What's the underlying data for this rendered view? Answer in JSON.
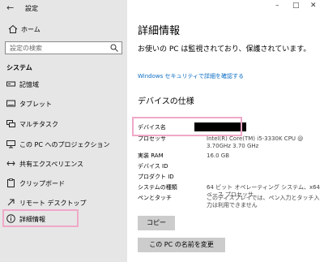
{
  "window": {
    "title": "設定",
    "back_icon": "back-arrow-icon"
  },
  "sidebar": {
    "home": {
      "label": "ホーム",
      "icon": "home-icon"
    },
    "search": {
      "placeholder": "設定の検索",
      "icon": "search-icon"
    },
    "section": "システム",
    "items": [
      {
        "label": "記憶域",
        "icon": "storage-icon"
      },
      {
        "label": "タブレット",
        "icon": "tablet-icon"
      },
      {
        "label": "マルチタスク",
        "icon": "multitasking-icon"
      },
      {
        "label": "この PC へのプロジェクション",
        "icon": "projection-icon"
      },
      {
        "label": "共有エクスペリエンス",
        "icon": "shared-experiences-icon"
      },
      {
        "label": "クリップボード",
        "icon": "clipboard-icon"
      },
      {
        "label": "リモート デスクトップ",
        "icon": "remote-desktop-icon"
      },
      {
        "label": "詳細情報",
        "icon": "info-icon",
        "selected": true
      }
    ]
  },
  "main": {
    "title": "詳細情報",
    "protect_text": "お使いの PC は監視されており、保護されています。",
    "security_link": "Windows セキュリティで詳細を確認する",
    "specs_title": "デバイスの仕様",
    "specs": [
      {
        "key": "デバイス名",
        "value": ""
      },
      {
        "key": "プロセッサ",
        "value": "Intel(R) Core(TM) i5-3330K CPU @ 3.70GHz 3.70 GHz"
      },
      {
        "key": "実装 RAM",
        "value": "16.0 GB"
      },
      {
        "key": "デバイス ID",
        "value": ""
      },
      {
        "key": "プロダクト ID",
        "value": ""
      },
      {
        "key": "システムの種類",
        "value": "64 ビット オペレーティング システム、x64 ベース プロセッサ"
      },
      {
        "key": "ペンとタッチ",
        "value": "このディスプレイでは、ペン入力とタッチ入力は利用できません"
      }
    ],
    "copy_button": "コピー",
    "rename_button": "この PC の名前を変更"
  },
  "colors": {
    "sidebar_bg": "#e6e6e6",
    "link": "#0a6cc4",
    "highlight": "#f0a8c8",
    "button_bg": "#cccccc"
  }
}
